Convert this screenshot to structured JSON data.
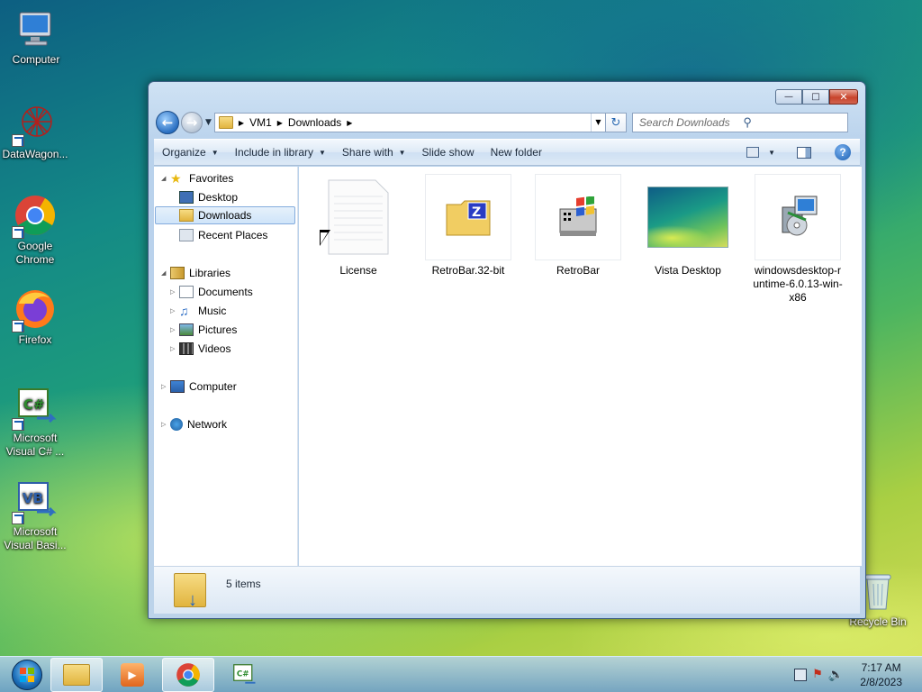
{
  "desktop": {
    "icons": [
      {
        "label": "Computer"
      },
      {
        "label": "DataWagon..."
      },
      {
        "label": "Google Chrome"
      },
      {
        "label": "Firefox"
      },
      {
        "label": "Microsoft Visual C# ..."
      },
      {
        "label": "Microsoft Visual Basi..."
      },
      {
        "label": "Recycle Bin"
      }
    ]
  },
  "window": {
    "controls": {
      "minimize": "minimize",
      "maximize": "maximize",
      "close": "close"
    },
    "breadcrumb": [
      "VM1",
      "Downloads"
    ],
    "search": {
      "placeholder": "Search Downloads"
    },
    "toolbar": {
      "organize": "Organize",
      "include_in_library": "Include in library",
      "share_with": "Share with",
      "slide_show": "Slide show",
      "new_folder": "New folder"
    },
    "nav": {
      "favorites": "Favorites",
      "desktop": "Desktop",
      "downloads": "Downloads",
      "recent_places": "Recent Places",
      "libraries": "Libraries",
      "documents": "Documents",
      "music": "Music",
      "pictures": "Pictures",
      "videos": "Videos",
      "computer": "Computer",
      "network": "Network"
    },
    "files": [
      {
        "name": "License",
        "icon": "text-document-icon"
      },
      {
        "name": "RetroBar.32-bit",
        "icon": "zip-folder-icon"
      },
      {
        "name": "RetroBar",
        "icon": "windows-app-icon"
      },
      {
        "name": "Vista Desktop",
        "icon": "image-thumbnail-icon"
      },
      {
        "name": "windowsdesktop-runtime-6.0.13-win-x86",
        "icon": "installer-icon"
      }
    ],
    "status": {
      "count": "5 items"
    }
  },
  "taskbar": {
    "clock": {
      "time": "7:17 AM",
      "date": "2/8/2023"
    }
  },
  "colors": {
    "selection": "#cfe4f9",
    "close_button": "#c8442c",
    "accent": "#1b5fb1"
  }
}
